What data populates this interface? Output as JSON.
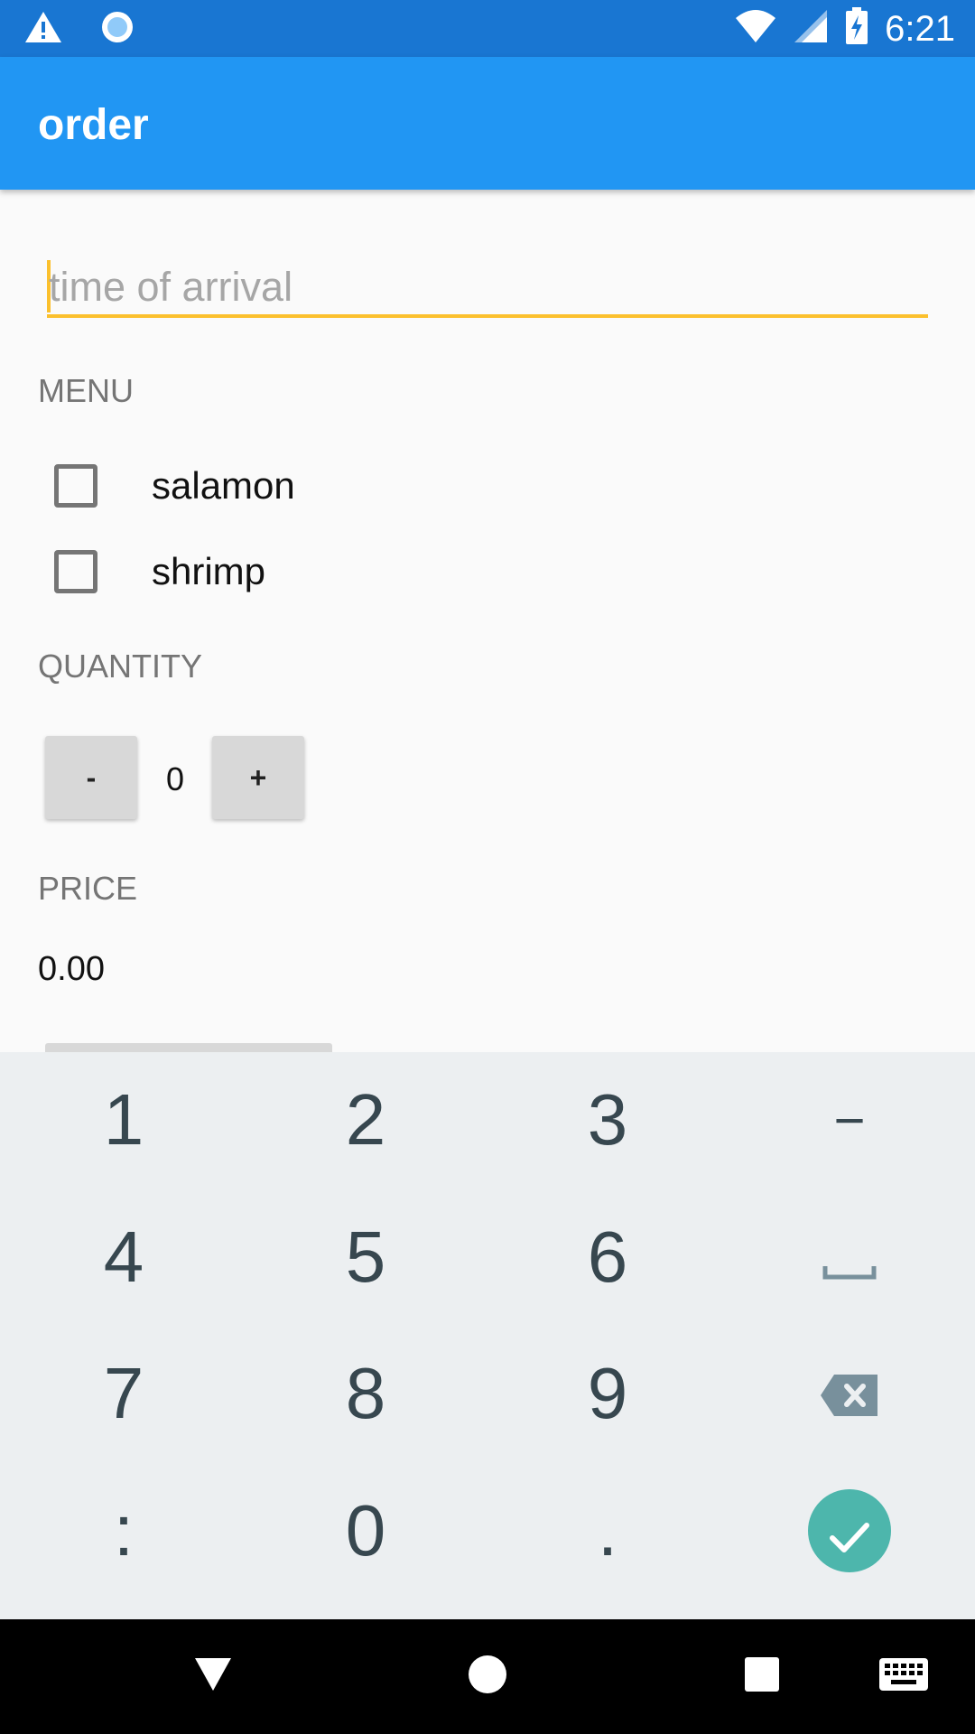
{
  "status_bar": {
    "time": "6:21",
    "icons": [
      "warning-icon",
      "circle-notification-icon",
      "wifi-icon",
      "signal-icon",
      "battery-charging-icon"
    ]
  },
  "app_bar": {
    "title": "order"
  },
  "form": {
    "arrival": {
      "placeholder": "time of arrival",
      "value": ""
    },
    "menu_label": "MENU",
    "menu_items": [
      {
        "label": "salamon",
        "checked": false
      },
      {
        "label": "shrimp",
        "checked": false
      }
    ],
    "quantity_label": "QUANTITY",
    "quantity": {
      "minus_label": "-",
      "value": "0",
      "plus_label": "+"
    },
    "price_label": "PRICE",
    "price_value": "0.00"
  },
  "keyboard": {
    "keys": [
      "1",
      "2",
      "3",
      "−",
      "4",
      "5",
      "6",
      "space",
      "7",
      "8",
      "9",
      "backspace",
      ":",
      "0",
      ".",
      "done"
    ],
    "key_labels": {
      "k1": "1",
      "k2": "2",
      "k3": "3",
      "k4": "4",
      "k5": "5",
      "k6": "6",
      "k7": "7",
      "k8": "8",
      "k9": "9",
      "k0": "0",
      "colon": ":",
      "dot": ".",
      "minus": "−"
    },
    "accent_color": "#4db6ac"
  },
  "colors": {
    "status_bar": "#1976d2",
    "app_bar": "#2196f3",
    "field_accent": "#fbc02d"
  },
  "nav_bar": {
    "icons": [
      "back-icon",
      "home-icon",
      "recents-icon",
      "keyboard-switch-icon"
    ]
  }
}
